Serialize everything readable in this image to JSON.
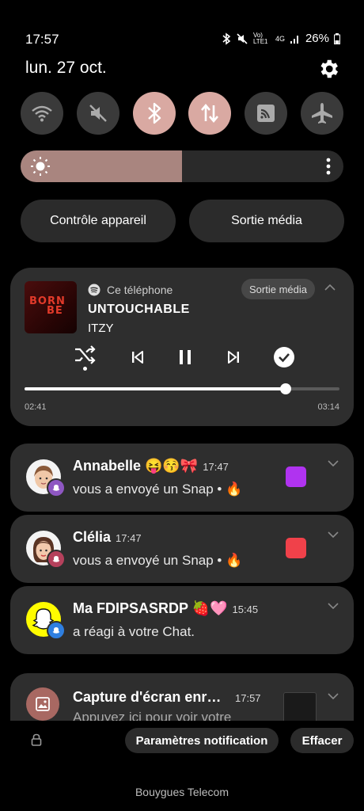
{
  "status_bar": {
    "time": "17:57",
    "network": "Vo) LTE1",
    "network_gen": "4G",
    "battery": "26%"
  },
  "header": {
    "date": "lun. 27 oct."
  },
  "quick_settings": [
    {
      "name": "wifi",
      "on": false
    },
    {
      "name": "mute",
      "on": false
    },
    {
      "name": "bluetooth",
      "on": true
    },
    {
      "name": "mobile-data",
      "on": true
    },
    {
      "name": "nfc",
      "on": false
    },
    {
      "name": "airplane",
      "on": false
    }
  ],
  "brightness": {
    "level": 0.5
  },
  "pills": {
    "device_control": "Contrôle appareil",
    "media_output": "Sortie média"
  },
  "media": {
    "album_art_text": [
      "BORN",
      "BE"
    ],
    "source": "Ce téléphone",
    "output_label": "Sortie média",
    "track": "UNTOUCHABLE",
    "artist": "ITZY",
    "position": "02:41",
    "duration": "03:14",
    "progress": 0.83
  },
  "notifications": [
    {
      "title": "Annabelle 😝😚🎀",
      "time": "17:47",
      "text": "vous a envoyé un Snap • 🔥",
      "color": "#b033f0"
    },
    {
      "title": "Clélia",
      "time": "17:47",
      "text": "vous a envoyé un Snap • 🔥",
      "color": "#f0414a"
    },
    {
      "title": "Ma FDIPSASRDP 🍓🩷",
      "time": "15:45",
      "text": "a réagi à votre Chat."
    },
    {
      "title": "Capture d'écran enr…",
      "time": "17:57",
      "text": "Appuyez ici pour voir votre"
    }
  ],
  "bottom": {
    "notif_settings": "Paramètres notification",
    "clear": "Effacer"
  },
  "carrier": "Bouygues Telecom",
  "colors": {
    "toggle_on": "#d9a9a2",
    "card": "#2e2e2e",
    "snap_yellow": "#fffc00"
  }
}
